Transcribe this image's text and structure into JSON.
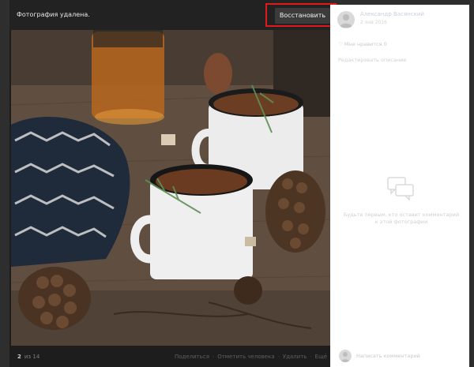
{
  "notice": {
    "text": "Фотография удалена.",
    "restore_label": "Восстановить"
  },
  "photo": {
    "description": "",
    "icon": "photo-image"
  },
  "footer": {
    "current": "2",
    "of_text": "из 14",
    "actions": [
      "Поделиться",
      "Отметить человека",
      "Удалить",
      "Ещё"
    ]
  },
  "sidebar": {
    "author": "Александр Васянский",
    "date": "2 янв 2016",
    "like_label": "Мне нравится",
    "like_count": "0",
    "edit_description": "Редактировать описание",
    "empty_comments_text": "Будьте первым, кто оставит комментарий к этой фотографии",
    "comment_placeholder": "Написать комментарий",
    "icons": {
      "like": "heart-icon",
      "comments": "speech-bubbles-icon",
      "avatar": "avatar"
    }
  },
  "colors": {
    "highlight": "#e0191b",
    "page_bg": "#2e2e2e",
    "bar_bg": "#222222",
    "sidebar_bg": "#ffffff"
  }
}
